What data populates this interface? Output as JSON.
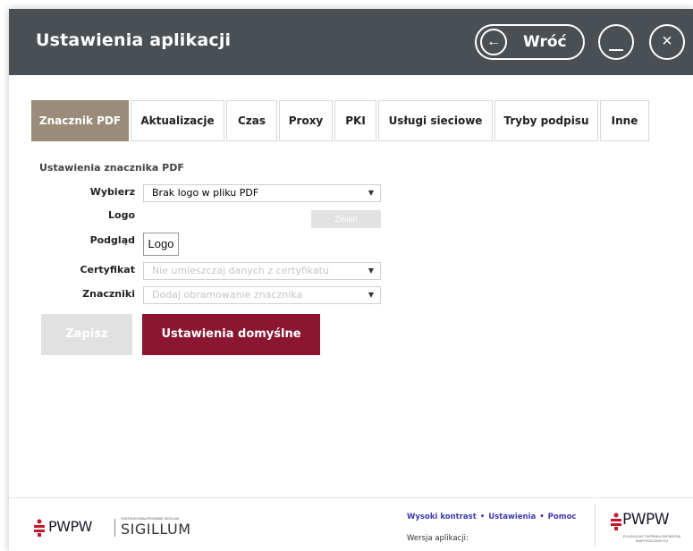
{
  "header": {
    "title": "Ustawienia aplikacji",
    "back_label": "Wróć"
  },
  "tabs": [
    {
      "label": "Znacznik PDF",
      "active": true
    },
    {
      "label": "Aktualizacje"
    },
    {
      "label": "Czas"
    },
    {
      "label": "Proxy"
    },
    {
      "label": "PKI"
    },
    {
      "label": "Usługi sieciowe"
    },
    {
      "label": "Tryby podpisu"
    },
    {
      "label": "Inne"
    }
  ],
  "form": {
    "section_title": "Ustawienia znacznika PDF",
    "wybierz_label": "Wybierz",
    "wybierz_value": "Brak logo w pliku PDF",
    "logo_label": "Logo",
    "change_button": "Zmień",
    "podglad_label": "Podgląd",
    "podglad_value": "Logo",
    "certyfikat_label": "Certyfikat",
    "certyfikat_value": "Nie umieszczaj danych z certyfikatu",
    "znaczniki_label": "Znaczniki",
    "znaczniki_value": "Dodaj obramowanie znacznika"
  },
  "buttons": {
    "save": "Zapisz",
    "defaults": "Ustawienia domyślne"
  },
  "footer": {
    "links": [
      "Wysoki kontrast",
      "Ustawienia",
      "Pomoc"
    ],
    "version_label": "Wersja aplikacji:",
    "logo_left_text": "PWPW",
    "sigillum_small": "CENTRUM KWALIFIKOWANE SIGILLUM",
    "sigillum_text": "SIGILLUM",
    "logo_right_text": "PWPW",
    "logo_right_sub": "POLSKA WYTWÓRNIA PAPIERÓW WARTOŚCIOWYCH"
  },
  "colors": {
    "header_bg": "#4a4f54",
    "active_tab": "#9a8c78",
    "primary_button": "#8c1530",
    "link": "#3d3bb0"
  }
}
